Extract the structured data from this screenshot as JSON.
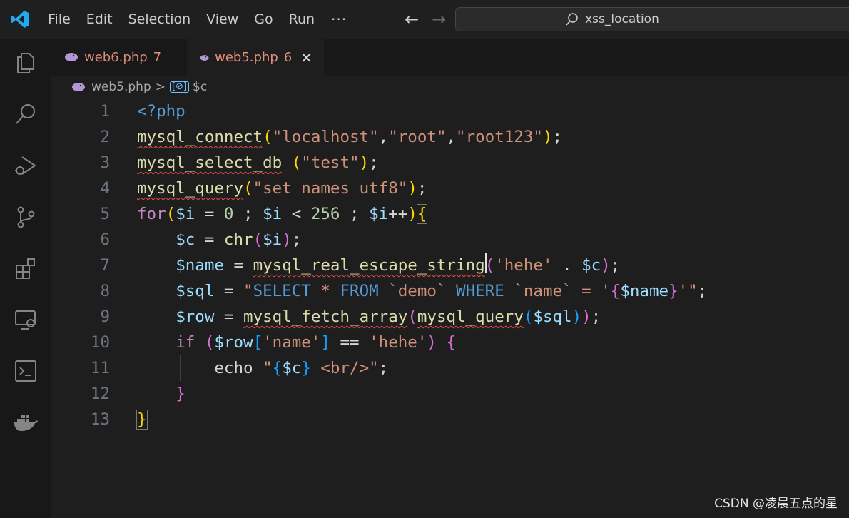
{
  "menu": [
    "File",
    "Edit",
    "Selection",
    "View",
    "Go",
    "Run"
  ],
  "menu_more": "···",
  "nav": {
    "back": "←",
    "forward": "→"
  },
  "search": {
    "text": "xss_location"
  },
  "tabs": [
    {
      "name": "web6.php",
      "badge": "7"
    },
    {
      "name": "web5.php",
      "badge": "6",
      "close": "✕"
    }
  ],
  "breadcrumb": {
    "file": "web5.php",
    "sep": ">",
    "symbol_icon": "[⊘]",
    "symbol": "$c"
  },
  "line_numbers": [
    "1",
    "2",
    "3",
    "4",
    "5",
    "6",
    "7",
    "8",
    "9",
    "10",
    "11",
    "12",
    "13"
  ],
  "code_lines": [
    "<?php",
    "mysql_connect(\"localhost\",\"root\",\"root123\");",
    "mysql_select_db (\"test\");",
    "mysql_query(\"set names utf8\");",
    "for($i = 0 ; $i < 256 ; $i++){",
    "    $c = chr($i);",
    "    $name = mysql_real_escape_string('hehe' . $c);",
    "    $sql = \"SELECT * FROM `demo` WHERE `name` = '{$name}'\";",
    "    $row = mysql_fetch_array(mysql_query($sql));",
    "    if ($row['name'] == 'hehe') {",
    "        echo \"{$c} <br/>\";",
    "    }",
    "}"
  ],
  "watermark": "CSDN @凌晨五点的星",
  "colors": {
    "accent": "#0078d4",
    "tab_text": "#e68f7a",
    "error": "#f14c4c"
  }
}
